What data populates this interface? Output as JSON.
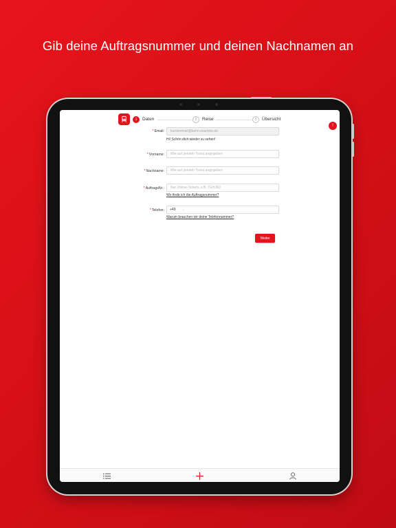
{
  "headline": "Gib deine Auftragsnummer und deinen Nachnamen an",
  "steps": [
    {
      "number": "1",
      "label": "Daten",
      "active": true
    },
    {
      "number": "2",
      "label": "Reise",
      "active": false
    },
    {
      "number": "3",
      "label": "Übersicht",
      "active": false
    }
  ],
  "alert_badge": "!",
  "form": {
    "email": {
      "label": "Email:",
      "value": "kundenmail@bahn.example.de",
      "hint": "Hi! Schön dich wieder zu sehen!"
    },
    "vorname": {
      "label": "Vorname:",
      "placeholder": "Wie auf deinem Ticket angegeben"
    },
    "nachname": {
      "label": "Nachname:",
      "placeholder": "Wie auf deinem Ticket angegeben"
    },
    "auftragsnr": {
      "label": "AuftragsNr.:",
      "placeholder": "Nur Online-Tickets, z.B. 7GHJ6D",
      "help_link": "Wo finde ich die Auftragsnummer?"
    },
    "telefon": {
      "label": "Telefon:",
      "prefix": "+49",
      "value": "",
      "help_link": "Warum brauchen wir deine Telefonnummer?"
    },
    "required_marker": "*"
  },
  "submit_label": "Weiter",
  "tabbar": {
    "items": [
      "list-icon",
      "plus-icon",
      "user-icon"
    ]
  },
  "colors": {
    "brand_red": "#e2141d",
    "background_red": "#d30f17"
  }
}
